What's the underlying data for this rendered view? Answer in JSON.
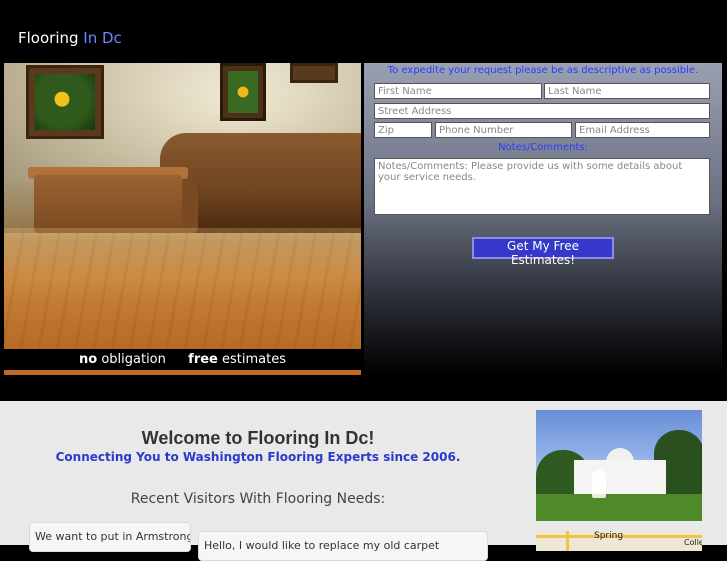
{
  "header": {
    "brand_main": "Flooring",
    "brand_accent": "In Dc"
  },
  "hero": {
    "caption_strong_1": "no",
    "caption_text_1": "obligation",
    "caption_strong_2": "free",
    "caption_text_2": "estimates"
  },
  "form": {
    "intro": "To expedite your request please be as descriptive as possible.",
    "first_name_placeholder": "First Name",
    "last_name_placeholder": "Last Name",
    "street_placeholder": "Street Address",
    "zip_placeholder": "Zip",
    "phone_placeholder": "Phone Number",
    "email_placeholder": "Email Address",
    "notes_label": "Notes/Comments:",
    "notes_placeholder": "Notes/Comments: Please provide us with some details about your service needs.",
    "submit_label": "Get My Free Estimates!"
  },
  "main": {
    "welcome_title": "Welcome to Flooring In Dc!",
    "tagline": "Connecting You to Washington Flooring Experts since 2006.",
    "visitors_heading": "Recent Visitors With Flooring Needs:",
    "visitor_cards": [
      "We want to put in Armstrong",
      "Hello, I would like to replace my old carpet"
    ]
  },
  "map": {
    "label_1": "Spring",
    "label_2": "Colle"
  }
}
